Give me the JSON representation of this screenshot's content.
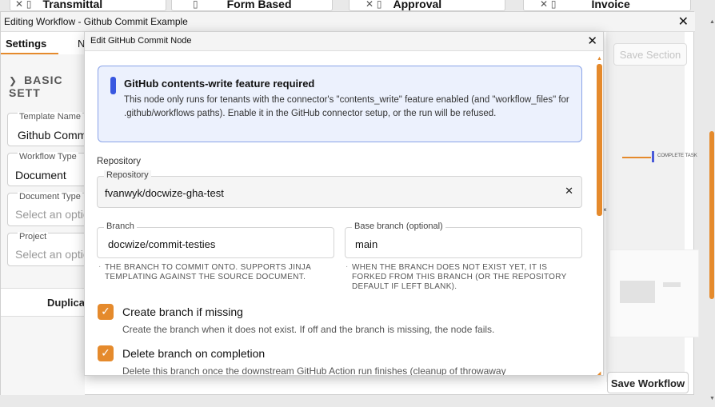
{
  "background_cards": [
    {
      "label": "Transmittal",
      "icon": "pin-icon"
    },
    {
      "label": "Form Based",
      "icon": "pin-icon"
    },
    {
      "label": "Approval",
      "icon": "pin-icon"
    },
    {
      "label": "Invoice",
      "icon": "pin-icon"
    }
  ],
  "window": {
    "title": "Editing Workflow - Github Commit Example",
    "tabs": {
      "settings": "Settings",
      "next": "N"
    },
    "section": "BASIC SETT",
    "fields": {
      "template_name": {
        "label": "Template Name",
        "value": "Github Commi"
      },
      "workflow_type": {
        "label": "Workflow Type",
        "value": "Document"
      },
      "document_type": {
        "label": "Document Type",
        "placeholder": "Select an optio"
      },
      "project": {
        "label": "Project",
        "placeholder": "Select an optio"
      }
    },
    "duplicate_button": "Duplicat",
    "save_section": "Save Section",
    "save_workflow": "Save Workflow",
    "canvas_tag": "COMPLETE TASK",
    "canvas_close": "×"
  },
  "modal": {
    "title": "Edit GitHub Commit Node",
    "alert": {
      "heading": "GitHub contents-write feature required",
      "body": "This node only runs for tenants with the connector's \"contents_write\" feature enabled (and \"workflow_files\" for .github/workflows paths). Enable it in the GitHub connector setup, or the run will be refused."
    },
    "repository_section": "Repository",
    "repository": {
      "label": "Repository",
      "value": "fvanwyk/docwize-gha-test"
    },
    "branch": {
      "label": "Branch",
      "value": "docwize/commit-testies",
      "helper": "THE BRANCH TO COMMIT ONTO. SUPPORTS JINJA TEMPLATING AGAINST THE SOURCE DOCUMENT."
    },
    "base_branch": {
      "label": "Base branch (optional)",
      "value": "main",
      "helper": "WHEN THE BRANCH DOES NOT EXIST YET, IT IS FORKED FROM THIS BRANCH (OR THE REPOSITORY DEFAULT IF LEFT BLANK)."
    },
    "checkboxes": [
      {
        "label": "Create branch if missing",
        "description": "Create the branch when it does not exist. If off and the branch is missing, the node fails.",
        "checked": true
      },
      {
        "label": "Delete branch on completion",
        "description": "Delete this branch once the downstream GitHub Action run finishes (cleanup of throwaway",
        "checked": true
      }
    ]
  },
  "colors": {
    "accent": "#e58a2c",
    "info": "#3857e0",
    "info_bg": "#ecf1fd"
  }
}
